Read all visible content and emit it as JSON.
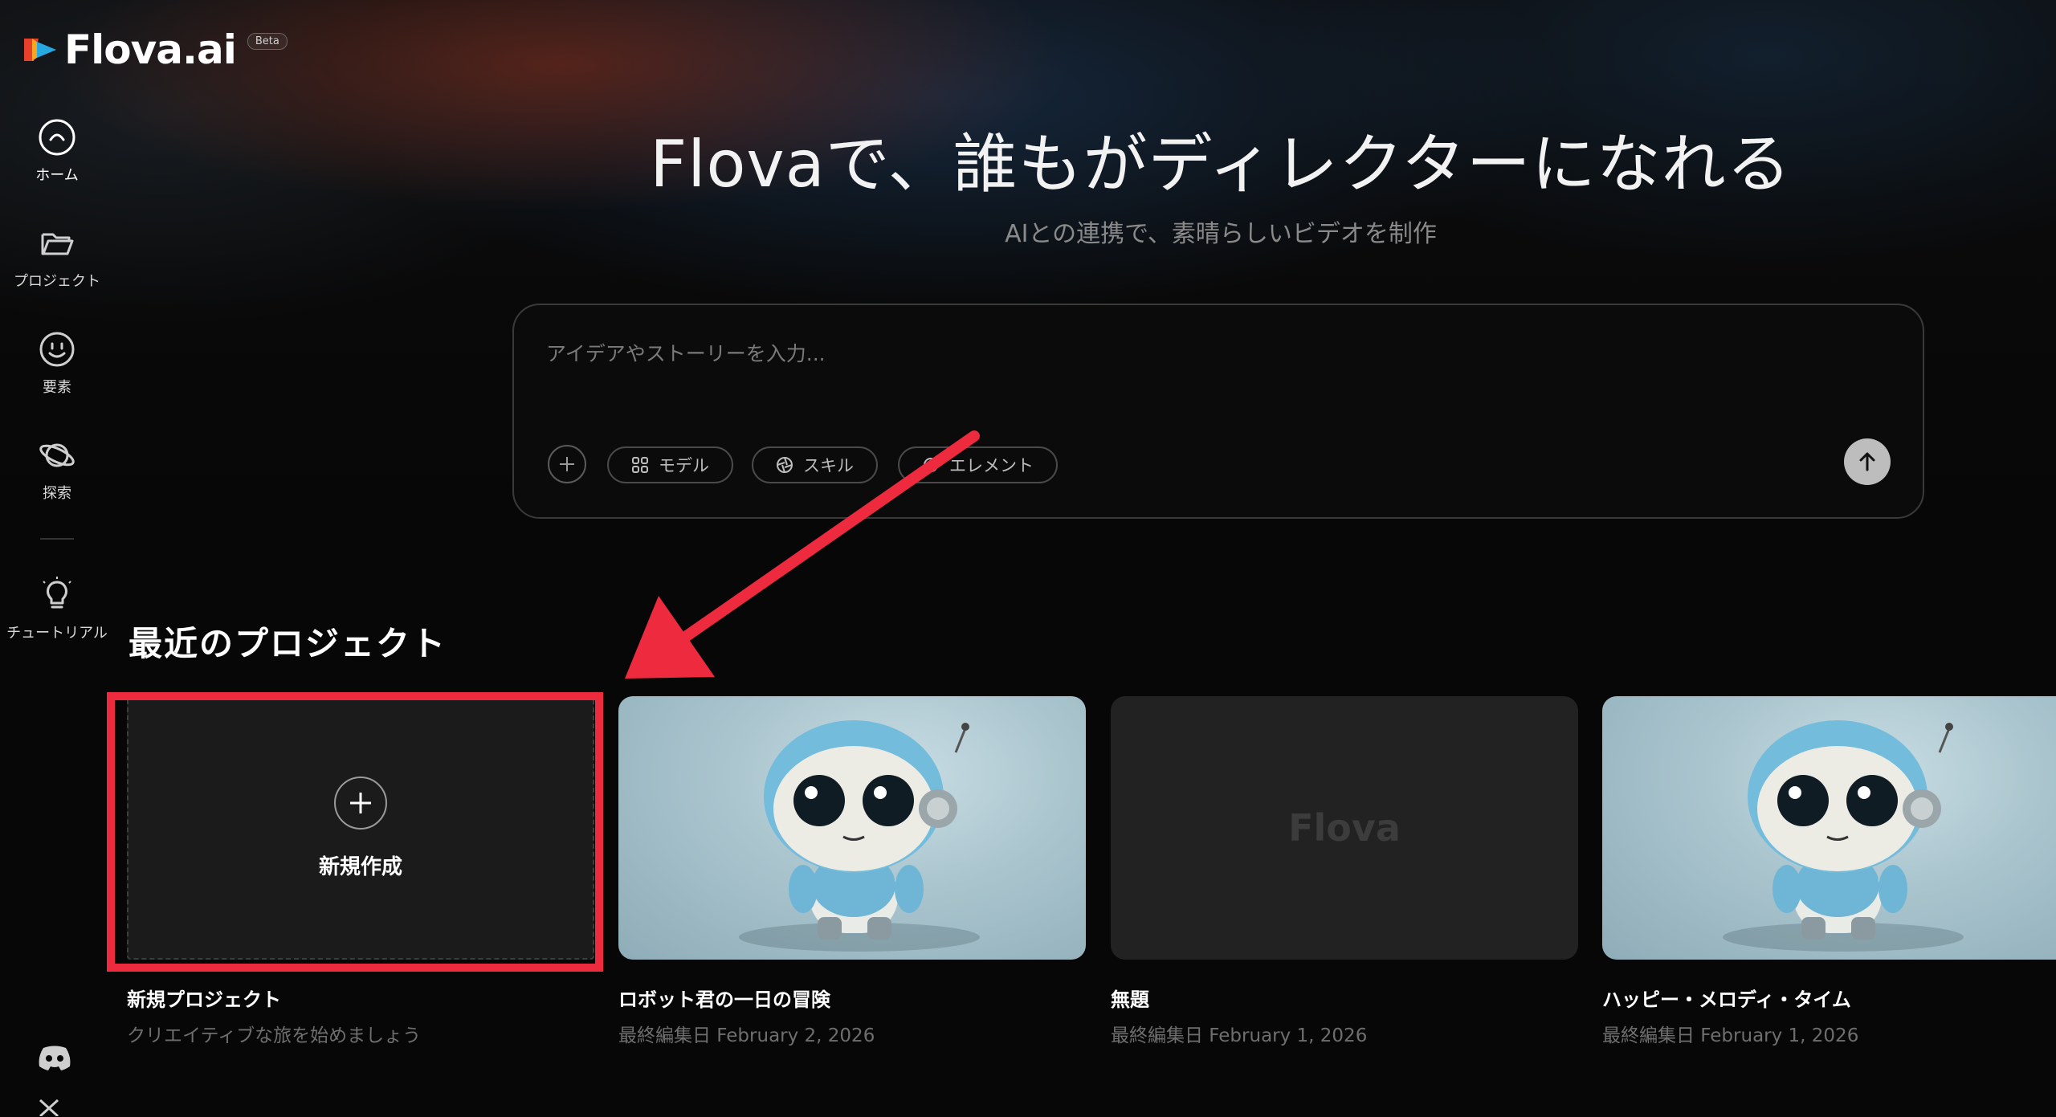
{
  "app": {
    "name": "Flova.ai",
    "badge": "Beta"
  },
  "sidebar": {
    "items": [
      {
        "label": "ホーム",
        "icon": "home-icon",
        "active": true
      },
      {
        "label": "プロジェクト",
        "icon": "folder-icon"
      },
      {
        "label": "要素",
        "icon": "smiley-icon"
      },
      {
        "label": "探索",
        "icon": "planet-icon"
      },
      {
        "label": "チュートリアル",
        "icon": "lightbulb-icon"
      }
    ],
    "social": [
      {
        "icon": "discord-icon"
      },
      {
        "icon": "x-icon"
      }
    ]
  },
  "hero": {
    "title": "Flovaで、誰もがディレクターになれる",
    "subtitle": "AIとの連携で、素晴らしいビデオを制作"
  },
  "prompt": {
    "placeholder": "アイデアやストーリーを入力...",
    "chips": [
      {
        "label": "モデル",
        "icon": "grid-icon"
      },
      {
        "label": "スキル",
        "icon": "aperture-icon"
      },
      {
        "label": "エレメント",
        "icon": "circle-icon"
      }
    ],
    "send_icon": "arrow-up-icon",
    "add_icon": "plus-icon"
  },
  "recent": {
    "title": "最近のプロジェクト",
    "new_card": {
      "label": "新規作成",
      "title": "新規プロジェクト",
      "subtitle": "クリエイティブな旅を始めましょう"
    },
    "projects": [
      {
        "title": "ロボット君の一日の冒険",
        "date": "最終編集日 February 2, 2026",
        "thumbnail": "robot"
      },
      {
        "title": "無題",
        "date": "最終編集日 February 1, 2026",
        "thumbnail": "blank",
        "watermark": "Flova"
      },
      {
        "title": "ハッピー・メロディ・タイム",
        "date": "最終編集日 February 1, 2026",
        "thumbnail": "robot"
      }
    ]
  },
  "colors": {
    "annotation": "#ee2a3f",
    "background": "#070707",
    "send_button": "#bdbdbd"
  }
}
